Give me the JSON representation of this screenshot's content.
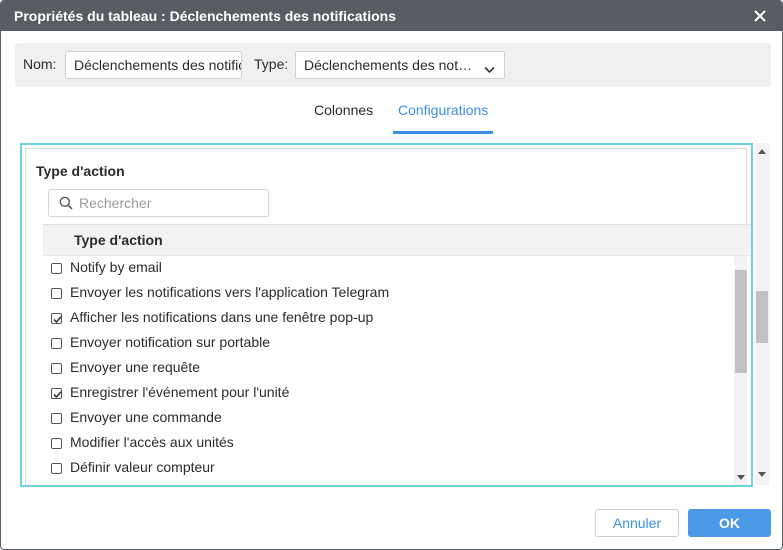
{
  "dialog": {
    "title": "Propriétés du tableau : Déclenchements des notifications"
  },
  "namebar": {
    "name_label": "Nom:",
    "name_value": "Déclenchements des notifications",
    "type_label": "Type:",
    "type_value": "Déclenchements des notifications"
  },
  "tabs": [
    {
      "label": "Colonnes",
      "active": false
    },
    {
      "label": "Configurations",
      "active": true
    }
  ],
  "config": {
    "section_title": "Type d'action",
    "search_placeholder": "Rechercher",
    "table_header": "Type d'action",
    "items": [
      {
        "label": "Notify by email",
        "checked": false
      },
      {
        "label": "Envoyer les notifications vers l'application Telegram",
        "checked": false
      },
      {
        "label": "Afficher les notifications dans une fenêtre pop-up",
        "checked": true
      },
      {
        "label": "Envoyer notification sur portable",
        "checked": false
      },
      {
        "label": "Envoyer une requête",
        "checked": false
      },
      {
        "label": "Enregistrer l'événement pour l'unité",
        "checked": true
      },
      {
        "label": "Envoyer une commande",
        "checked": false
      },
      {
        "label": "Modifier l'accès aux unités",
        "checked": false
      },
      {
        "label": "Définir valeur compteur",
        "checked": false
      }
    ]
  },
  "footer": {
    "cancel_label": "Annuler",
    "ok_label": "OK"
  },
  "colors": {
    "titlebar": "#585d63",
    "accent": "#3b8fe4",
    "focus_border": "#6fd3dd"
  }
}
